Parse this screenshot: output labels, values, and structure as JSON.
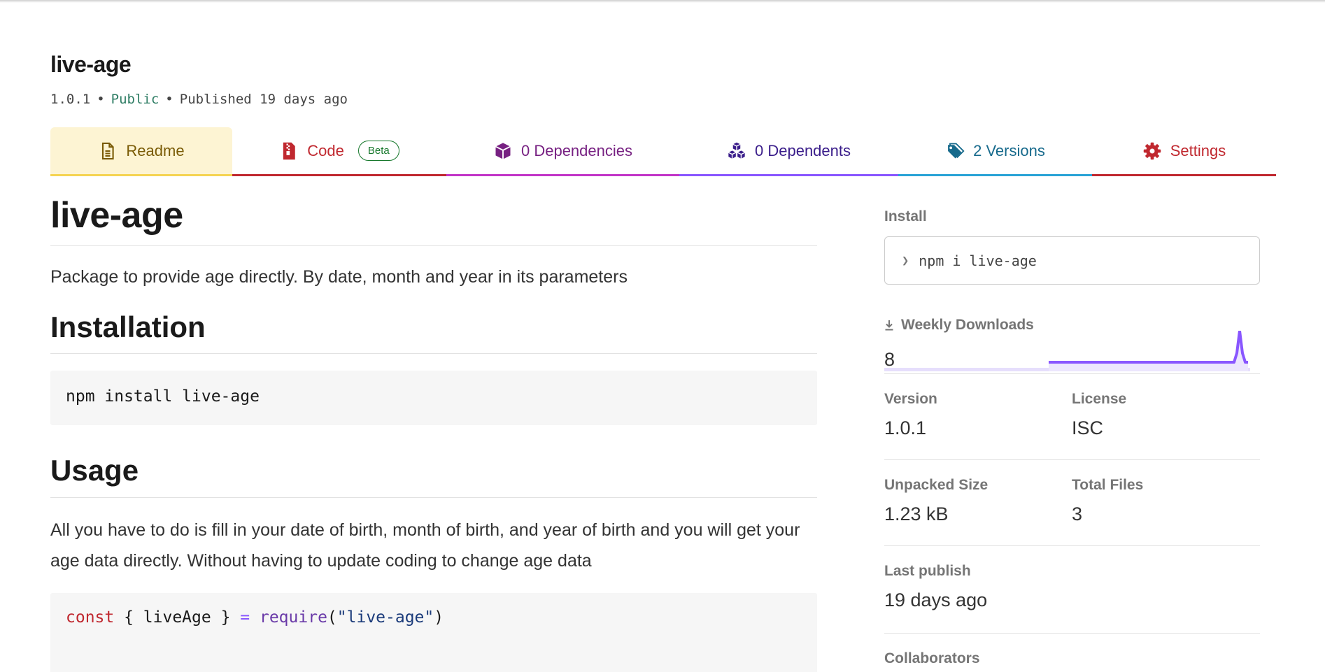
{
  "package": {
    "name": "live-age",
    "version": "1.0.1",
    "visibility": "Public",
    "separator": "•",
    "published": "Published 19 days ago"
  },
  "tabs": {
    "readme": "Readme",
    "code": "Code",
    "code_badge": "Beta",
    "dependencies": "0 Dependencies",
    "dependents": "0 Dependents",
    "versions": "2 Versions",
    "settings": "Settings"
  },
  "readme": {
    "title": "live-age",
    "description": "Package to provide age directly. By date, month and year in its parameters",
    "installation_heading": "Installation",
    "install_code": "npm install live-age",
    "usage_heading": "Usage",
    "usage_text": "All you have to do is fill in your date of birth, month of birth, and year of birth and you will get your age data directly. Without having to update coding to change age data",
    "usage_code": {
      "keyword": "const",
      "destructure": " { liveAge } ",
      "operator": "=",
      "function": "require",
      "open": "(",
      "string": "\"live-age\"",
      "close": ")"
    }
  },
  "sidebar": {
    "install_label": "Install",
    "install_prompt": "❯",
    "install_command": "npm i live-age",
    "weekly_downloads_label": "Weekly Downloads",
    "weekly_downloads_value": "8",
    "version_label": "Version",
    "version_value": "1.0.1",
    "license_label": "License",
    "license_value": "ISC",
    "unpacked_size_label": "Unpacked Size",
    "unpacked_size_value": "1.23 kB",
    "total_files_label": "Total Files",
    "total_files_value": "3",
    "last_publish_label": "Last publish",
    "last_publish_value": "19 days ago",
    "collaborators_label": "Collaborators"
  },
  "colors": {
    "readme_tab": "#f5d452",
    "code_tab": "#c0282f",
    "dependencies_tab": "#c234c7",
    "dependents_tab": "#8956ff",
    "versions_tab": "#29a3d6",
    "settings_tab": "#c0282f",
    "sparkline": "#8956ff"
  }
}
